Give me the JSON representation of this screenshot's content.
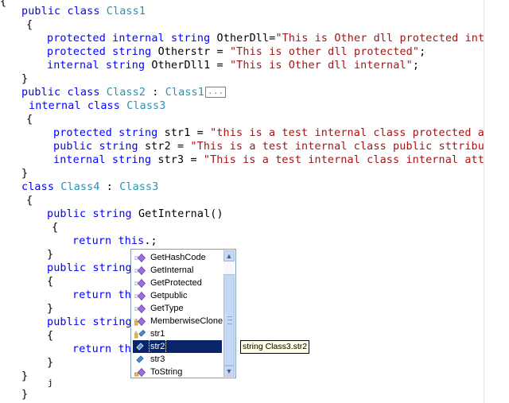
{
  "code": {
    "l0_brace": "{",
    "l1": {
      "kw": "public class ",
      "ty": "Class1"
    },
    "l2": "{",
    "l3": {
      "kw": "protected internal string ",
      "tx": "OtherDll=",
      "st": "\"This is Other dll protected inte"
    },
    "l4": {
      "kw": "protected string ",
      "tx": "Otherstr = ",
      "st": "\"This is other dll protected\"",
      "end": ";"
    },
    "l5": {
      "kw": "internal string ",
      "tx": "OtherDll1 = ",
      "st": "\"This is Other dll internal\"",
      "end": ";"
    },
    "l6": "}",
    "l7": {
      "kw": "public class ",
      "ty": "Class2",
      "tx": " : ",
      "ty2": "Class1",
      "collapsed": "..."
    },
    "l8": {
      "kw": "internal class ",
      "ty": "Class3"
    },
    "l9": "{",
    "l10": {
      "kw": "protected string ",
      "tx": "str1 = ",
      "st": "\"this is a test internal class protected at"
    },
    "l11": {
      "kw": "public string ",
      "tx": "str2 = ",
      "st": "\"This is a test internal class public sttribut"
    },
    "l12": {
      "kw": "internal string ",
      "tx": "str3 = ",
      "st": "\"This is a test internal class internal attr"
    },
    "l13": "}",
    "l14": {
      "kw": "class ",
      "ty": "Class4",
      "tx": " : ",
      "ty2": "Class3"
    },
    "l15": "{",
    "l16": {
      "kw": "public string ",
      "tx": "GetInternal()"
    },
    "l17": "{",
    "l18": {
      "kw": "return this",
      "tx": ".;"
    },
    "l19": "}",
    "l20": {
      "kw": "public string"
    },
    "l21": "{",
    "l22": {
      "kw": "return th"
    },
    "l23": "}",
    "l24": {
      "kw": "public string"
    },
    "l25": "{",
    "l26": {
      "kw": "return th"
    },
    "l27": "}",
    "l28": "}",
    "l29": "j",
    "l30": "}"
  },
  "intellisense": {
    "items": [
      {
        "label": "GetHashCode",
        "icon": "method-icon"
      },
      {
        "label": "GetInternal",
        "icon": "method-icon"
      },
      {
        "label": "GetProtected",
        "icon": "method-icon"
      },
      {
        "label": "Getpublic",
        "icon": "method-icon"
      },
      {
        "label": "GetType",
        "icon": "method-icon"
      },
      {
        "label": "MemberwiseClone",
        "icon": "protected-method-icon"
      },
      {
        "label": "str1",
        "icon": "protected-field-icon"
      },
      {
        "label": "str2",
        "icon": "field-icon"
      },
      {
        "label": "str3",
        "icon": "field-icon"
      },
      {
        "label": "ToString",
        "icon": "method-icon"
      }
    ],
    "selected": "str2",
    "scroll_up": "▲",
    "scroll_down": "▼"
  },
  "tooltip": "string Class3.str2",
  "colors": {
    "keyword": "#0000ff",
    "type": "#2b91af",
    "string": "#a31515",
    "selection": "#0a246a",
    "tooltip_bg": "#ffffe1"
  }
}
